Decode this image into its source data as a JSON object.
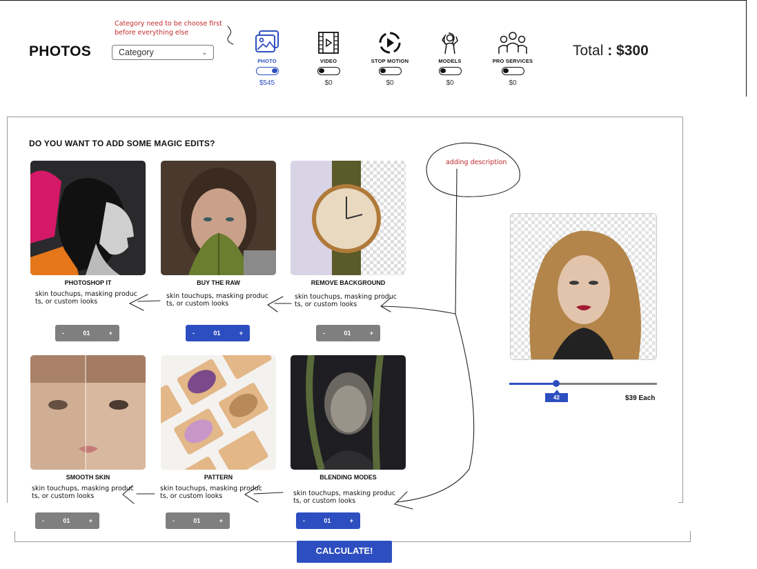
{
  "header": {
    "title": "PHOTOS",
    "category_select": {
      "value": "Category"
    },
    "category_note": "Category need to be choose first before everything else",
    "services": [
      {
        "key": "photo",
        "label": "PHOTO",
        "price": "$545",
        "active": true,
        "icon": "image-icon"
      },
      {
        "key": "video",
        "label": "VIDEO",
        "price": "$0",
        "active": false,
        "icon": "film-icon"
      },
      {
        "key": "stop-motion",
        "label": "STOP MOTION",
        "price": "$0",
        "active": false,
        "icon": "play-circle-icon"
      },
      {
        "key": "models",
        "label": "MODELS",
        "price": "$0",
        "active": false,
        "icon": "model-icon"
      },
      {
        "key": "pro-services",
        "label": "PRO SERVICES",
        "price": "$0",
        "active": false,
        "icon": "team-icon"
      }
    ],
    "total_label": "Total",
    "total_sep": " : ",
    "total_value": "$300"
  },
  "edits": {
    "title": "DO YOU WANT TO ADD SOME MAGIC EDITS?",
    "items": [
      {
        "title": "PHOTOSHOP IT",
        "desc": "skin touchups, masking produc ts, or custom looks",
        "qty": "01",
        "qty_minus": "-",
        "qty_plus": "+",
        "selected": false
      },
      {
        "title": "BUY THE RAW",
        "desc": "skin touchups, masking produc ts, or custom looks",
        "qty": "01",
        "qty_minus": "-",
        "qty_plus": "+",
        "selected": true
      },
      {
        "title": "REMOVE BACKGROUND",
        "desc": "skin touchups, masking produc ts, or custom looks",
        "qty": "01",
        "qty_minus": "-",
        "qty_plus": "+",
        "selected": false
      },
      {
        "title": "SMOOTH SKIN",
        "desc": "skin touchups, masking produc ts, or custom looks",
        "qty": "01",
        "qty_minus": "-",
        "qty_plus": "+",
        "selected": false
      },
      {
        "title": "PATTERN",
        "desc": "skin touchups, masking produc ts, or custom looks",
        "qty": "01",
        "qty_minus": "-",
        "qty_plus": "+",
        "selected": false
      },
      {
        "title": "BLENDING MODES",
        "desc": "skin touchups, masking produc ts, or custom looks",
        "qty": "01",
        "qty_minus": "-",
        "qty_plus": "+",
        "selected": true
      }
    ]
  },
  "annotation": {
    "desc_note": "adding description"
  },
  "preview": {
    "slider_value": "42",
    "slider_fraction": 0.32,
    "each_price": "$39 Each"
  },
  "actions": {
    "calculate": "CALCULATE!"
  },
  "colors": {
    "accent": "#2d4ec0",
    "note": "#c0282b",
    "stepper_gray": "#7f7f7f"
  }
}
